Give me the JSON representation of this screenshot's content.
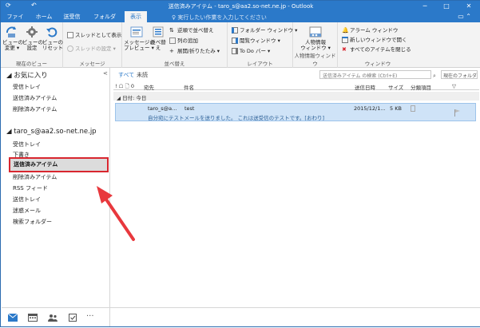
{
  "window": {
    "title": "送信済みアイテム - taro_s@aa2.so-net.ne.jp - Outlook",
    "qa_send_receive": "⟳",
    "qa_undo": "↶",
    "minimize": "─",
    "maximize": "□",
    "close": "✕"
  },
  "ribbon_tabs": {
    "file": "ファイル",
    "home": "ホーム",
    "send_receive": "送受信",
    "folder": "フォルダー",
    "view": "表示",
    "tell_me": "♀ 実行したい作業を入力してください",
    "right_ctrl": "▭ ⌃"
  },
  "ribbon": {
    "current_view": {
      "change_view": "ビューの\n変更 ▾",
      "view_settings": "ビューの\n設定",
      "reset_view": "ビューの\nリセット",
      "label": "現在のビュー"
    },
    "messages": {
      "show_as_thread": "スレッドとして表示",
      "thread_settings": "スレッドの設定 ▾",
      "label": "メッセージ"
    },
    "arrangement": {
      "message_preview": "メッセージの\nプレビュー ▾",
      "arrange_by": "並べ替え",
      "reverse_sort": "逆順で並べ替え",
      "add_columns": "列の追加",
      "expand_collapse": "展開/折りたたみ ▾",
      "label": "並べ替え"
    },
    "layout": {
      "folder_pane": "フォルダー ウィンドウ ▾",
      "reading_pane": "閲覧ウィンドウ ▾",
      "todo_bar": "To Do バー ▾",
      "label": "レイアウト"
    },
    "people_pane": {
      "people_pane": "人物情報\nウィンドウ ▾",
      "label": "人物情報ウィンドウ"
    },
    "window": {
      "reminders": "アラーム ウィンドウ",
      "open_new_window": "新しいウィンドウで開く",
      "close_all_items": "すべてのアイテムを閉じる",
      "label": "ウィンドウ"
    }
  },
  "folder_pane": {
    "favorites_header": "◢ お気に入り",
    "collapse": "<",
    "favorites": [
      "受信トレイ",
      "送信済みアイテム",
      "削除済みアイテム"
    ],
    "account_header": "◢ taro_s@aa2.so-net.ne.jp",
    "account_folders": [
      "受信トレイ",
      "下書き",
      "送信済みアイテム",
      "削除済みアイテム",
      "RSS フィード",
      "送信トレイ",
      "迷惑メール",
      "検索フォルダー"
    ]
  },
  "message_list": {
    "filter_all": "すべて",
    "filter_unread": "未読",
    "search_placeholder": "送信済みアイテム の検索 (Ctrl+E)",
    "search_scope": "現在のフォルダー ▾",
    "columns": {
      "icons": "! ☖ 🗋 0",
      "to": "宛先",
      "subject": "件名",
      "sent": "送信日時",
      "size": "サイズ",
      "category": "分類項目",
      "flag": "▽"
    },
    "group_header": "◢ 日付: 今日",
    "messages": [
      {
        "to": "taro_s@a…",
        "subject": "test",
        "preview": "自分宛にテストメールを送りました。 これは送受信のテストです。[おわり]",
        "sent": "2015/12/1...",
        "size": "5 KB"
      }
    ]
  },
  "bottom_nav": {
    "more": "···"
  },
  "colors": {
    "accent": "#2b79c9",
    "highlight": "#d8262f",
    "selected_row": "#cfe3f7"
  }
}
